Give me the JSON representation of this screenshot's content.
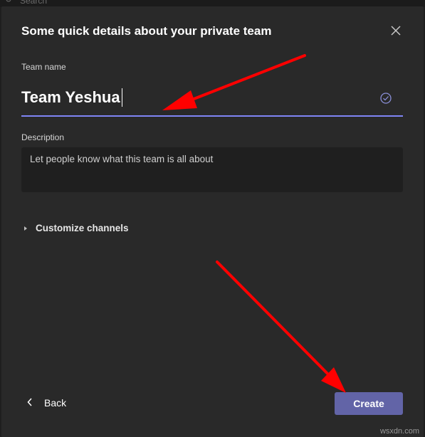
{
  "topbar": {
    "search_text": "Search"
  },
  "dialog": {
    "title": "Some quick details about your private team",
    "team_name_label": "Team name",
    "team_name_value": "Team Yeshua",
    "description_label": "Description",
    "description_placeholder": "Let people know what this team is all about",
    "customize_channels": "Customize channels",
    "back_label": "Back",
    "create_label": "Create"
  },
  "colors": {
    "background": "#292929",
    "accent": "#6264a7",
    "input_underline": "#7f85f5",
    "annotation_arrow": "#ff0000"
  },
  "watermark": "wsxdn.com"
}
